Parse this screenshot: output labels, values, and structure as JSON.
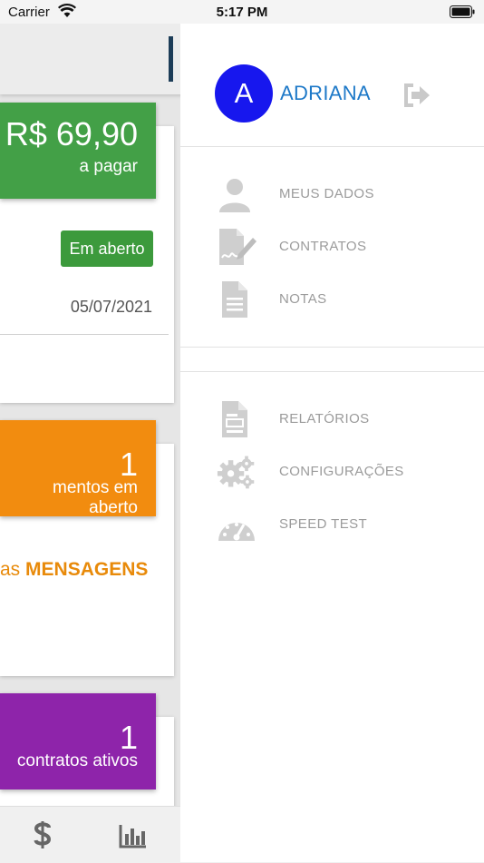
{
  "status_bar": {
    "carrier": "Carrier",
    "time": "5:17 PM"
  },
  "background": {
    "payment_tile": {
      "amount": "R$ 69,90",
      "caption": "a pagar",
      "color": "#43a047"
    },
    "status_badge": "Em aberto",
    "due_date": "05/07/2021",
    "attendance_tile": {
      "count": "1",
      "caption": "mentos em aberto",
      "color": "#f28c0f"
    },
    "messages_prefix": "as",
    "messages_emphasis": "MENSAGENS",
    "contracts_tile": {
      "count": "1",
      "caption": "contratos ativos",
      "color": "#8e24aa"
    },
    "tabbar": {
      "icons": [
        "dollar-icon",
        "bar-chart-icon"
      ]
    }
  },
  "drawer": {
    "avatar_letter": "A",
    "username": "ADRIANA",
    "menu_primary": [
      {
        "label": "MEUS DADOS",
        "icon": "user-icon"
      },
      {
        "label": "CONTRATOS",
        "icon": "contract-signature-icon"
      },
      {
        "label": "NOTAS",
        "icon": "document-icon"
      }
    ],
    "menu_secondary": [
      {
        "label": "RELATÓRIOS",
        "icon": "report-icon"
      },
      {
        "label": "CONFIGURAÇÕES",
        "icon": "gears-icon"
      },
      {
        "label": "SPEED TEST",
        "icon": "speedometer-icon"
      }
    ]
  },
  "colors": {
    "accent": "#1e79c8",
    "avatar": "#1717ee",
    "menu_text": "#9b9b9b"
  }
}
